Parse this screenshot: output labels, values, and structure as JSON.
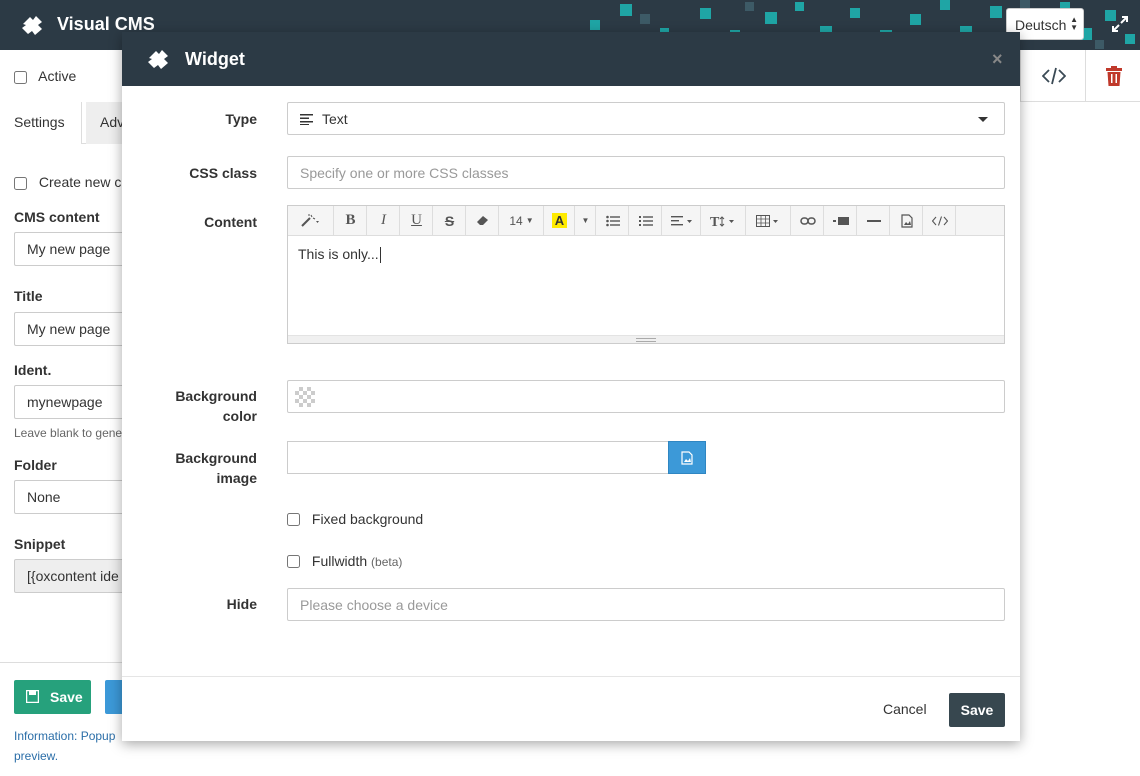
{
  "topbar": {
    "title": "Visual CMS",
    "language": "Deutsch"
  },
  "sidebar": {
    "active_label": "Active",
    "tabs": [
      {
        "label": "Settings"
      },
      {
        "label": "Adv"
      }
    ],
    "create_new_label": "Create new co",
    "cms_content_label": "CMS content",
    "cms_content_value": "My new page",
    "title_label": "Title",
    "title_value": "My new page",
    "ident_label": "Ident.",
    "ident_value": "mynewpage",
    "ident_help": "Leave blank to gene",
    "folder_label": "Folder",
    "folder_value": "None",
    "snippet_label": "Snippet",
    "snippet_value": "[{oxcontent ide",
    "save_label": "Save",
    "info_text_1": "Information: Popup",
    "info_text_2": "preview."
  },
  "modal": {
    "title": "Widget",
    "close_glyph": "×",
    "type_label": "Type",
    "type_value": "Text",
    "css_label": "CSS class",
    "css_placeholder": "Specify one or more CSS classes",
    "content_label": "Content",
    "content_text": "This is only...",
    "toolbar": {
      "font_size": "14"
    },
    "bg_color_label_1": "Background",
    "bg_color_label_2": "color",
    "bg_image_label_1": "Background",
    "bg_image_label_2": "image",
    "fixed_bg_label": "Fixed background",
    "fullwidth_label": "Fullwidth",
    "fullwidth_beta": "(beta)",
    "hide_label": "Hide",
    "hide_placeholder": "Please choose a device",
    "cancel_label": "Cancel",
    "save_label": "Save"
  },
  "colors": {
    "header_bg": "#2c3a45",
    "save_green": "#26a17c",
    "accent_blue": "#3c99d8",
    "puzzle_teal": "#1fa5a5",
    "trash_red": "#c0392b"
  }
}
